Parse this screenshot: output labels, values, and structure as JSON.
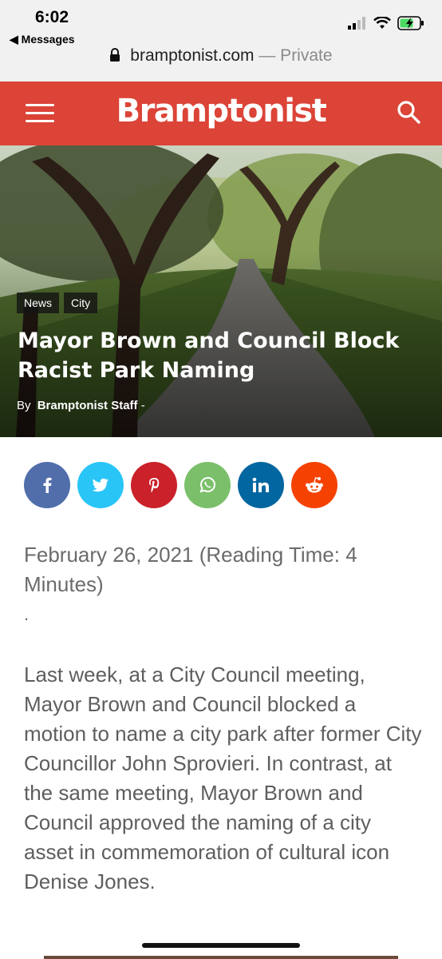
{
  "status_bar": {
    "time": "6:02",
    "back_label": "◀ Messages",
    "address_domain": "bramptonist.com",
    "address_suffix": " — Private"
  },
  "header": {
    "logo": "Bramptonist",
    "brand_color": "#db4437",
    "menu_icon": "hamburger-menu-icon",
    "search_icon": "search-icon"
  },
  "hero": {
    "tags": [
      "News",
      "City"
    ],
    "title": "Mayor Brown and Council Block Racist Park Naming",
    "byline_prefix": "By",
    "author": "Bramptonist Staff",
    "byline_suffix": "-"
  },
  "share": [
    {
      "name": "facebook",
      "color": "#516eab"
    },
    {
      "name": "twitter",
      "color": "#29c5f6"
    },
    {
      "name": "pinterest",
      "color": "#ca212a"
    },
    {
      "name": "whatsapp",
      "color": "#7bbf6a"
    },
    {
      "name": "linkedin",
      "color": "#0266a0"
    },
    {
      "name": "reddit",
      "color": "#f54200"
    }
  ],
  "article": {
    "meta": "February 26, 2021 (Reading Time: 4 Minutes)",
    "separator": ".",
    "paragraph": "Last week, at a City Council meeting, Mayor Brown and Council blocked a motion to name a city park after former City Councillor John Sprovieri. In contrast, at the same meeting, Mayor Brown and Council approved the naming of a city asset in commemoration of cultural icon Denise Jones."
  }
}
